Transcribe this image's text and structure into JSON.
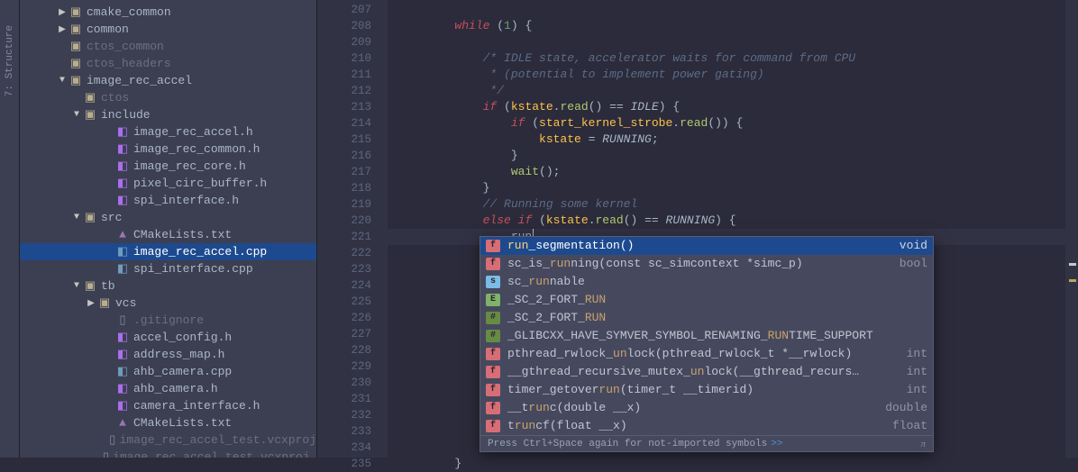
{
  "sidebar_tab": {
    "label": "7: Structure"
  },
  "tree": [
    {
      "indent": 40,
      "toggle": "▶",
      "icon": "folder",
      "label": "cmake_common"
    },
    {
      "indent": 40,
      "toggle": "▶",
      "icon": "folder",
      "label": "common"
    },
    {
      "indent": 40,
      "toggle": "",
      "icon": "folder",
      "label": "ctos_common",
      "dim": true
    },
    {
      "indent": 40,
      "toggle": "",
      "icon": "folder",
      "label": "ctos_headers",
      "dim": true
    },
    {
      "indent": 40,
      "toggle": "▼",
      "icon": "folder",
      "label": "image_rec_accel"
    },
    {
      "indent": 56,
      "toggle": "",
      "icon": "folder",
      "label": "ctos",
      "dim": true
    },
    {
      "indent": 56,
      "toggle": "▼",
      "icon": "folder",
      "label": "include"
    },
    {
      "indent": 92,
      "toggle": "",
      "icon": "file-h",
      "label": "image_rec_accel.h"
    },
    {
      "indent": 92,
      "toggle": "",
      "icon": "file-h",
      "label": "image_rec_common.h"
    },
    {
      "indent": 92,
      "toggle": "",
      "icon": "file-h",
      "label": "image_rec_core.h"
    },
    {
      "indent": 92,
      "toggle": "",
      "icon": "file-h",
      "label": "pixel_circ_buffer.h"
    },
    {
      "indent": 92,
      "toggle": "",
      "icon": "file-h",
      "label": "spi_interface.h"
    },
    {
      "indent": 56,
      "toggle": "▼",
      "icon": "folder",
      "label": "src"
    },
    {
      "indent": 92,
      "toggle": "",
      "icon": "file-cmake",
      "label": "CMakeLists.txt"
    },
    {
      "indent": 92,
      "toggle": "",
      "icon": "file-cpp",
      "label": "image_rec_accel.cpp",
      "selected": true
    },
    {
      "indent": 92,
      "toggle": "",
      "icon": "file-cpp",
      "label": "spi_interface.cpp"
    },
    {
      "indent": 56,
      "toggle": "▼",
      "icon": "folder",
      "label": "tb"
    },
    {
      "indent": 72,
      "toggle": "▶",
      "icon": "folder",
      "label": "vcs"
    },
    {
      "indent": 92,
      "toggle": "",
      "icon": "file-generic",
      "label": ".gitignore",
      "dim": true
    },
    {
      "indent": 92,
      "toggle": "",
      "icon": "file-h",
      "label": "accel_config.h"
    },
    {
      "indent": 92,
      "toggle": "",
      "icon": "file-h",
      "label": "address_map.h"
    },
    {
      "indent": 92,
      "toggle": "",
      "icon": "file-cpp",
      "label": "ahb_camera.cpp"
    },
    {
      "indent": 92,
      "toggle": "",
      "icon": "file-h",
      "label": "ahb_camera.h"
    },
    {
      "indent": 92,
      "toggle": "",
      "icon": "file-h",
      "label": "camera_interface.h"
    },
    {
      "indent": 92,
      "toggle": "",
      "icon": "file-cmake",
      "label": "CMakeLists.txt"
    },
    {
      "indent": 92,
      "toggle": "",
      "icon": "file-generic",
      "label": "image_rec_accel_test.vcxproj",
      "dim": true
    },
    {
      "indent": 92,
      "toggle": "",
      "icon": "file-generic",
      "label": "image_rec_accel_test.vcxproj.filters",
      "dim": true
    }
  ],
  "gutter": {
    "start": 207,
    "end": 235,
    "current": 221
  },
  "code": {
    "typed_suffix": "run",
    "l208": {
      "while_kw": "while",
      "lparen": " (",
      "one": "1",
      "rparen": ") {"
    },
    "l210": {
      "text": "/* IDLE state, accelerator waits for command from CPU"
    },
    "l211": {
      "text": " * (potential to implement power gating)"
    },
    "l212": {
      "text": " */"
    },
    "l213": {
      "if_kw": "if",
      "lp": " (",
      "id": "kstate",
      "dot": ".",
      "m": "read",
      "call": "() == ",
      "c": "IDLE",
      "rp": ") {"
    },
    "l214": {
      "if_kw": "if",
      "lp": " (",
      "id": "start_kernel_strobe",
      "dot": ".",
      "m": "read",
      "call": "()) {"
    },
    "l215": {
      "id": "kstate",
      "eq": " = ",
      "c": "RUNNING",
      "semi": ";"
    },
    "l216": {
      "brace": "}"
    },
    "l217": {
      "m": "wait",
      "call": "();"
    },
    "l218": {
      "brace": "}"
    },
    "l219": {
      "text": "// Running some kernel"
    },
    "l220": {
      "else_kw": "else",
      "sp": " ",
      "if_kw": "if",
      "lp": " (",
      "id": "kstate",
      "dot": ".",
      "m": "read",
      "call": "() == ",
      "c": "RUNNING",
      "rp": ") {"
    },
    "l235": {
      "brace": "}"
    }
  },
  "completion": {
    "items": [
      {
        "kind": "f",
        "label_pre": "",
        "match": "run",
        "label_post": "_segmentation()",
        "ret": "void",
        "selected": true
      },
      {
        "kind": "f",
        "label_pre": "sc_is_",
        "match": "run",
        "label_post": "ning(const sc_simcontext *simc_p)",
        "ret": "bool"
      },
      {
        "kind": "s",
        "label_pre": "sc_",
        "match": "run",
        "label_post": "nable",
        "ret": ""
      },
      {
        "kind": "e",
        "label_pre": "_SC_2_FORT_",
        "match": "RUN",
        "label_post": "",
        "ret": ""
      },
      {
        "kind": "hash",
        "label_pre": "_SC_2_FORT_",
        "match": "RUN",
        "label_post": "",
        "ret": ""
      },
      {
        "kind": "hash",
        "label_pre": "_GLIBCXX_HAVE_SYMVER_SYMBOL_RENAMING_",
        "match": "RUN",
        "label_post": "TIME_SUPPORT",
        "ret": ""
      },
      {
        "kind": "f",
        "label_pre": "pthread_rwlock_",
        "match": "un",
        "label_post": "lock(pthread_rwlock_t *__rwlock)",
        "ret": "int"
      },
      {
        "kind": "f",
        "label_pre": "__gthread_recursive_mutex_",
        "match": "un",
        "label_post": "lock(__gthread_recurs…",
        "ret": "int"
      },
      {
        "kind": "f",
        "label_pre": "timer_getover",
        "match": "run",
        "label_post": "(timer_t __timerid)",
        "ret": "int"
      },
      {
        "kind": "f",
        "label_pre": "__t",
        "match": "run",
        "label_post": "c(double __x)",
        "ret": "double"
      },
      {
        "kind": "f",
        "label_pre": "t",
        "match": "run",
        "label_post": "cf(float __x)",
        "ret": "float"
      }
    ],
    "footer": {
      "text": "Press Ctrl+Space again for not-imported symbols",
      "link": ">>",
      "pi": "π"
    }
  }
}
